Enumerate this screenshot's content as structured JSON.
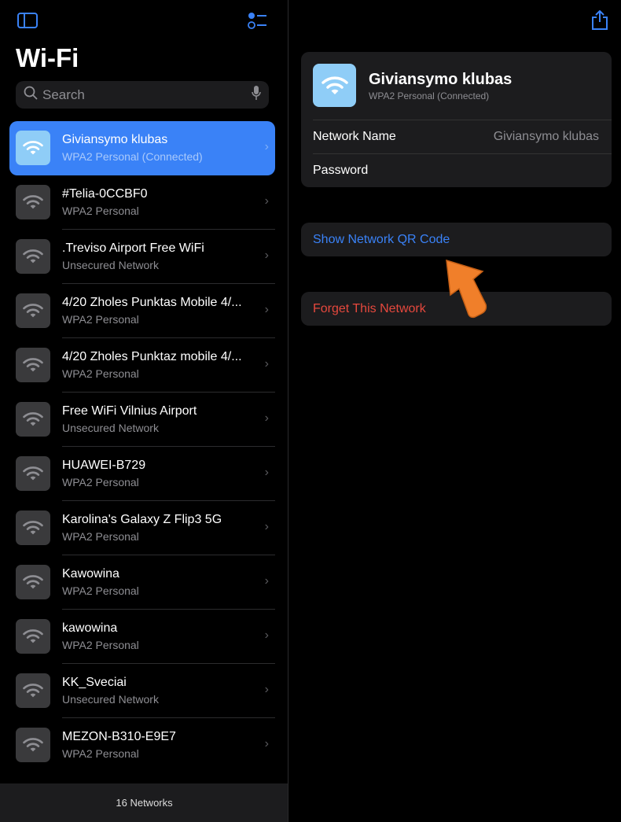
{
  "sidebar": {
    "title": "Wi-Fi",
    "search_placeholder": "Search",
    "networks": [
      {
        "name": "Giviansymo klubas",
        "security": "WPA2 Personal (Connected)",
        "selected": true
      },
      {
        "name": "#Telia-0CCBF0",
        "security": "WPA2 Personal"
      },
      {
        "name": ".Treviso Airport Free WiFi",
        "security": "Unsecured Network"
      },
      {
        "name": "4/20 Zholes Punktas Mobile 4/...",
        "security": "WPA2 Personal"
      },
      {
        "name": "4/20 Zholes Punktaz mobile 4/...",
        "security": "WPA2 Personal"
      },
      {
        "name": "Free WiFi Vilnius Airport",
        "security": "Unsecured Network"
      },
      {
        "name": "HUAWEI-B729",
        "security": "WPA2 Personal"
      },
      {
        "name": "Karolina's Galaxy Z Flip3 5G",
        "security": "WPA2 Personal"
      },
      {
        "name": "Kawowina",
        "security": "WPA2 Personal"
      },
      {
        "name": "kawowina",
        "security": "WPA2 Personal"
      },
      {
        "name": "KK_Sveciai",
        "security": "Unsecured Network"
      },
      {
        "name": "MEZON-B310-E9E7",
        "security": "WPA2 Personal"
      }
    ],
    "footer": "16 Networks"
  },
  "detail": {
    "name": "Giviansymo klubas",
    "security": "WPA2 Personal (Connected)",
    "network_name_label": "Network Name",
    "network_name_value": "Giviansymo klubas",
    "password_label": "Password",
    "qr_label": "Show Network QR Code",
    "forget_label": "Forget This Network"
  },
  "colors": {
    "accent": "#3a82f7",
    "destructive": "#e5483d",
    "arrow": "#f07f2a"
  }
}
